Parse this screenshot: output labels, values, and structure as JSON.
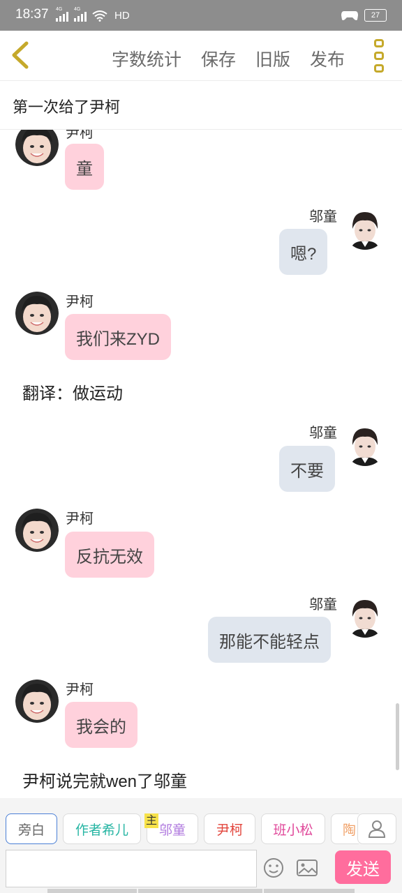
{
  "status_bar": {
    "time": "18:37",
    "net1": "4G",
    "net2": "4G",
    "hd": "HD",
    "battery": "27"
  },
  "toolbar": {
    "actions": [
      "字数统计",
      "保存",
      "旧版",
      "发布"
    ]
  },
  "chapter": {
    "title": "第一次给了尹柯"
  },
  "characters": {
    "left": "尹柯",
    "right": "邬童"
  },
  "messages": [
    {
      "side": "left",
      "speaker": "尹柯",
      "text": "童"
    },
    {
      "side": "right",
      "speaker": "邬童",
      "text": "嗯?"
    },
    {
      "side": "left",
      "speaker": "尹柯",
      "text": "我们来ZYD"
    },
    {
      "side": "narration",
      "text": "翻译：做运动"
    },
    {
      "side": "right",
      "speaker": "邬童",
      "text": "不要"
    },
    {
      "side": "left",
      "speaker": "尹柯",
      "text": "反抗无效"
    },
    {
      "side": "right",
      "speaker": "邬童",
      "text": "那能不能轻点"
    },
    {
      "side": "left",
      "speaker": "尹柯",
      "text": "我会的"
    },
    {
      "side": "narration",
      "text": "尹柯说完就wen了邬童"
    }
  ],
  "input": {
    "roles": [
      {
        "label": "旁白",
        "color": "#666666"
      },
      {
        "label": "作者希儿",
        "color": "#26b5a3"
      },
      {
        "label": "邬童",
        "color": "#b07adf",
        "main_tag": "主"
      },
      {
        "label": "尹柯",
        "color": "#e2453c"
      },
      {
        "label": "班小松",
        "color": "#e0489a"
      },
      {
        "label": "陶",
        "color": "#f0a067"
      }
    ],
    "placeholder": "",
    "send_label": "发送"
  },
  "colors": {
    "left_bubble": "#ffd1dc",
    "right_bubble": "#e0e6ee",
    "send_button": "#ff6d9d",
    "accent_icon": "#c5a92b"
  }
}
